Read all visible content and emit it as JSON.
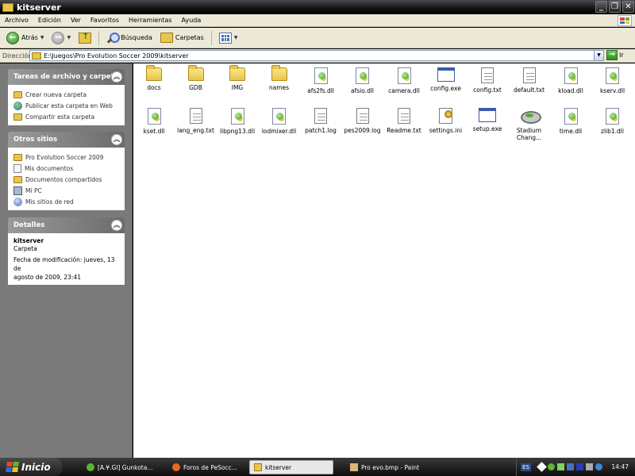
{
  "window": {
    "title": "kitserver"
  },
  "menu": [
    "Archivo",
    "Edición",
    "Ver",
    "Favoritos",
    "Herramientas",
    "Ayuda"
  ],
  "toolbar": {
    "back_label": "Atrás",
    "search_label": "Búsqueda",
    "folders_label": "Carpetas"
  },
  "address": {
    "label": "Dirección",
    "value": "E:\\Juegos\\Pro Evolution Soccer 2009\\kitserver",
    "go_label": "Ir"
  },
  "panels": {
    "tasks": {
      "title": "Tareas de archivo y carpeta",
      "items": [
        "Crear nueva carpeta",
        "Publicar esta carpeta en Web",
        "Compartir esta carpeta"
      ]
    },
    "other": {
      "title": "Otros sitios",
      "items": [
        "Pro Evolution Soccer 2009",
        "Mis documentos",
        "Documentos compartidos",
        "Mi PC",
        "Mis sitios de red"
      ]
    },
    "details": {
      "title": "Detalles",
      "name": "kitserver",
      "type": "Carpeta",
      "modified_1": "Fecha de modificación: jueves, 13 de",
      "modified_2": "agosto de 2009, 23:41"
    }
  },
  "files": [
    {
      "name": "docs",
      "kind": "folder"
    },
    {
      "name": "GDB",
      "kind": "folder"
    },
    {
      "name": "IMG",
      "kind": "folder"
    },
    {
      "name": "names",
      "kind": "folder"
    },
    {
      "name": "afs2fs.dll",
      "kind": "dll"
    },
    {
      "name": "afsio.dll",
      "kind": "dll"
    },
    {
      "name": "camera.dll",
      "kind": "dll"
    },
    {
      "name": "config.exe",
      "kind": "exe"
    },
    {
      "name": "config.txt",
      "kind": "txt"
    },
    {
      "name": "default.txt",
      "kind": "txt"
    },
    {
      "name": "kload.dll",
      "kind": "dll"
    },
    {
      "name": "kserv.dll",
      "kind": "dll"
    },
    {
      "name": "kset.dll",
      "kind": "dll"
    },
    {
      "name": "lang_eng.txt",
      "kind": "txt"
    },
    {
      "name": "libpng13.dll",
      "kind": "dll"
    },
    {
      "name": "lodmixer.dll",
      "kind": "dll"
    },
    {
      "name": "patch1.log",
      "kind": "txt"
    },
    {
      "name": "pes2009.log",
      "kind": "txt"
    },
    {
      "name": "Readme.txt",
      "kind": "txt"
    },
    {
      "name": "settings.ini",
      "kind": "ini"
    },
    {
      "name": "setup.exe",
      "kind": "exe"
    },
    {
      "name": "Stadium Chang...",
      "kind": "stadium"
    },
    {
      "name": "time.dll",
      "kind": "dll"
    },
    {
      "name": "zlib1.dll",
      "kind": "dll"
    }
  ],
  "taskbar": {
    "start_label": "Inicio",
    "tasks": [
      "[A.¥.GI] Gunkota...",
      "Foros de PeSocc...",
      "kitserver",
      "Pro evo.bmp - Paint"
    ],
    "lang": "ES",
    "clock": "14:47"
  },
  "colors": {
    "folder": "#e8c64a",
    "chrome": "#ece9d8",
    "pane": "#7a7a7a",
    "taskbar": "#0d0d0d"
  }
}
